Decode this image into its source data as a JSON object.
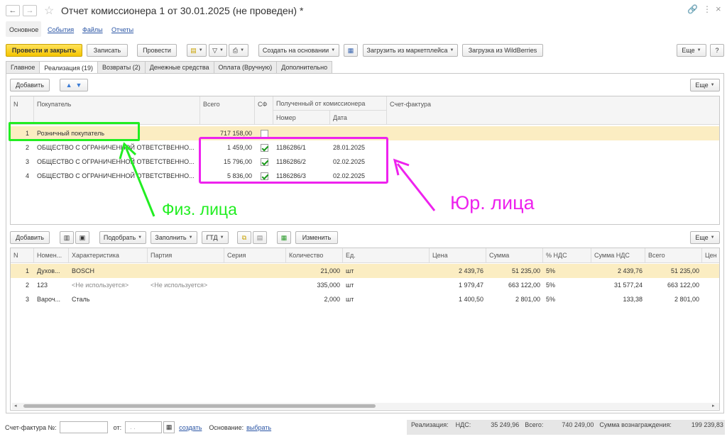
{
  "window": {
    "title": "Отчет комиссионера 1 от 30.01.2025 (не проведен) *",
    "back_icon": "arrow-left-icon",
    "forward_icon": "arrow-right-icon",
    "star_icon": "star-outline-icon",
    "link_icon": "link-icon",
    "more_icon": "vertical-dots-icon",
    "close_icon": "close-icon"
  },
  "subtabs": [
    "Основное",
    "События",
    "Файлы",
    "Отчеты"
  ],
  "toolbar": {
    "post_close": "Провести и закрыть",
    "save": "Записать",
    "post": "Провести",
    "create_based": "Создать на основании",
    "load_marketplace": "Загрузить из маркетплейса",
    "load_wb": "Загрузка из WildBerries",
    "more": "Еще",
    "help": "?"
  },
  "tabs": [
    "Главное",
    "Реализация (19)",
    "Возвраты (2)",
    "Денежные средства",
    "Оплата (Вручную)",
    "Дополнительно"
  ],
  "upper": {
    "add": "Добавить",
    "more": "Еще",
    "headers": {
      "n": "N",
      "buyer": "Покупатель",
      "total": "Всего",
      "sf": "СФ",
      "received": "Полученный от комиссионера",
      "number": "Номер",
      "date": "Дата",
      "invoice": "Счет-фактура"
    },
    "rows": [
      {
        "n": "1",
        "buyer": "Розничный покупатель",
        "total": "717 158,00",
        "sf": false,
        "number": "",
        "date": ""
      },
      {
        "n": "2",
        "buyer": "ОБЩЕСТВО С ОГРАНИЧЕННОЙ ОТВЕТСТВЕННО...",
        "total": "1 459,00",
        "sf": true,
        "number": "1186286/1",
        "date": "28.01.2025"
      },
      {
        "n": "3",
        "buyer": "ОБЩЕСТВО С ОГРАНИЧЕННОЙ ОТВЕТСТВЕННО...",
        "total": "15 796,00",
        "sf": true,
        "number": "1186286/2",
        "date": "02.02.2025"
      },
      {
        "n": "4",
        "buyer": "ОБЩЕСТВО С ОГРАНИЧЕННОЙ ОТВЕТСТВЕННО...",
        "total": "5 836,00",
        "sf": true,
        "number": "1186286/3",
        "date": "02.02.2025"
      }
    ]
  },
  "annotations": {
    "individuals": "Физ. лица",
    "legal": "Юр. лица",
    "green": "#22ee22",
    "magenta": "#ee22ee"
  },
  "lower": {
    "add": "Добавить",
    "pick": "Подобрать",
    "fill": "Заполнить",
    "gtd": "ГТД",
    "change": "Изменить",
    "more": "Еще",
    "headers": {
      "n": "N",
      "nom": "Номен...",
      "char": "Характеристика",
      "batch": "Партия",
      "series": "Серия",
      "qty": "Количество",
      "unit": "Ед.",
      "price": "Цена",
      "sum": "Сумма",
      "vat_pct": "% НДС",
      "vat_sum": "Сумма НДС",
      "total": "Всего",
      "price2": "Цен"
    },
    "rows": [
      {
        "n": "1",
        "nom": "Духов...",
        "char": "BOSCH",
        "batch": "",
        "series": "",
        "qty": "21,000",
        "unit": "шт",
        "price": "2 439,76",
        "sum": "51 235,00",
        "vat_pct": "5%",
        "vat_sum": "2 439,76",
        "total": "51 235,00"
      },
      {
        "n": "2",
        "nom": "123",
        "char": "<Не используется>",
        "batch": "<Не используется>",
        "series": "",
        "qty": "335,000",
        "unit": "шт",
        "price": "1 979,47",
        "sum": "663 122,00",
        "vat_pct": "5%",
        "vat_sum": "31 577,24",
        "total": "663 122,00"
      },
      {
        "n": "3",
        "nom": "Вароч...",
        "char": "Сталь",
        "batch": "",
        "series": "",
        "qty": "2,000",
        "unit": "шт",
        "price": "1 400,50",
        "sum": "2 801,00",
        "vat_pct": "5%",
        "vat_sum": "133,38",
        "total": "2 801,00"
      }
    ]
  },
  "footer": {
    "invoice_label": "Счет-фактура №:",
    "from_label": "от:",
    "date_placeholder": ". .",
    "create_link": "создать",
    "basis_label": "Основание:",
    "choose_link": "выбрать",
    "summary_label": "Реализация:",
    "vat_label": "НДС:",
    "vat_value": "35 249,96",
    "total_label": "Всего:",
    "total_value": "740 249,00",
    "reward_label": "Сумма вознаграждения:",
    "reward_value": "199 239,83"
  }
}
